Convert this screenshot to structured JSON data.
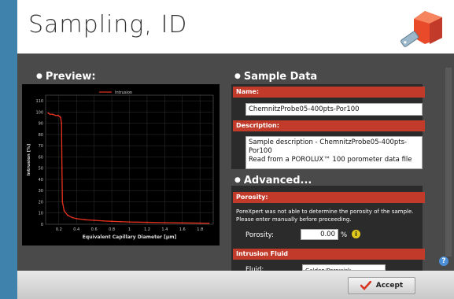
{
  "window": {
    "title": "Sampling, ID"
  },
  "preview": {
    "heading": "Preview:",
    "legend": "Intrusion",
    "ylabel": "Intrusion [%]",
    "xlabel": "Equivalent Capillary Diameter [μm]",
    "yticks": [
      "0",
      "10",
      "20",
      "30",
      "40",
      "50",
      "60",
      "70",
      "80",
      "90",
      "100",
      "110"
    ],
    "xticks": [
      "0.2",
      "0.4",
      "0.6",
      "0.8",
      "1",
      "1.2",
      "1.4",
      "1.6",
      "1.8"
    ]
  },
  "chart_data": {
    "type": "line",
    "title": "",
    "xlabel": "Equivalent Capillary Diameter [μm]",
    "ylabel": "Intrusion [%]",
    "xlim": [
      0.05,
      1.95
    ],
    "ylim": [
      0,
      115
    ],
    "grid": true,
    "legend": "top",
    "series": [
      {
        "name": "Intrusion",
        "color": "#e8321e",
        "x": [
          0.08,
          0.1,
          0.13,
          0.16,
          0.19,
          0.21,
          0.22,
          0.23,
          0.235,
          0.24,
          0.26,
          0.3,
          0.35,
          0.4,
          0.5,
          0.6,
          0.7,
          0.8,
          0.9,
          1.0,
          1.2,
          1.4,
          1.6,
          1.8,
          1.9
        ],
        "y": [
          99,
          98,
          98,
          97,
          97,
          96,
          95,
          90,
          50,
          20,
          12,
          8,
          6,
          5,
          4,
          3.5,
          3,
          2.6,
          2.3,
          2,
          1.7,
          1.4,
          1.2,
          1,
          0.9
        ]
      }
    ]
  },
  "sample_data": {
    "heading": "Sample Data",
    "name_label": "Name:",
    "name_value": "ChemnitzProbe05-400pts-Por100",
    "description_label": "Description:",
    "description_line1": "Sample description - ChemnitzProbe05-400pts-Por100",
    "description_line2": "Read from a POROLUX™ 100 porometer data file"
  },
  "advanced": {
    "heading": "Advanced...",
    "porosity_label": "Porosity:",
    "porosity_note": "PoreXpert was not able to determine the porosity of the sample. Please enter manually before proceeding.",
    "porosity_field_label": "Porosity:",
    "porosity_value": "0.00",
    "porosity_unit": "%",
    "intrusion_fluid_label": "Intrusion Fluid",
    "fluid_field_label": "Fluid:",
    "fluid_value": "Galden/Porewick"
  },
  "footer": {
    "accept_label": "Accept"
  },
  "colors": {
    "accent_red": "#c23a2a",
    "plot_line": "#e8321e",
    "check": "#d9331f"
  }
}
